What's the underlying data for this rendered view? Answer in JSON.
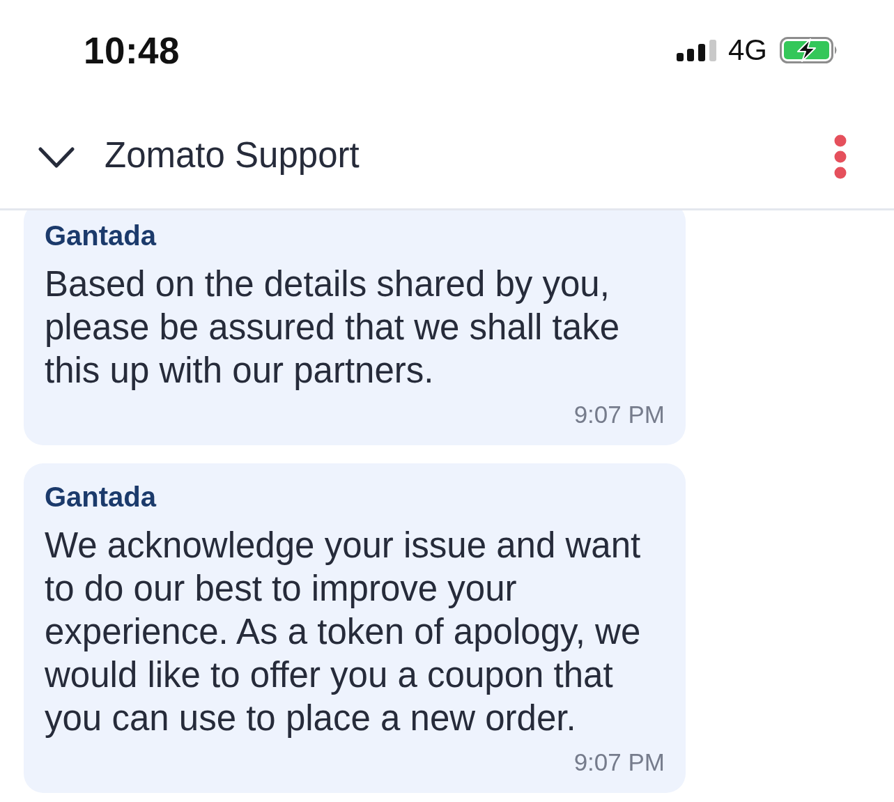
{
  "status_bar": {
    "time": "10:48",
    "network": "4G",
    "charging": true
  },
  "header": {
    "title": "Zomato Support"
  },
  "messages": [
    {
      "sender": "Gantada",
      "text": "Based on the details shared by you, please be assured that we shall take this up with our partners.",
      "time": "9:07 PM"
    },
    {
      "sender": "Gantada",
      "text": "We acknowledge your issue and want to do our best to improve your experience. As a token of apology, we would like to offer you a coupon that you can use to place a new order.",
      "time": "9:07 PM"
    }
  ]
}
